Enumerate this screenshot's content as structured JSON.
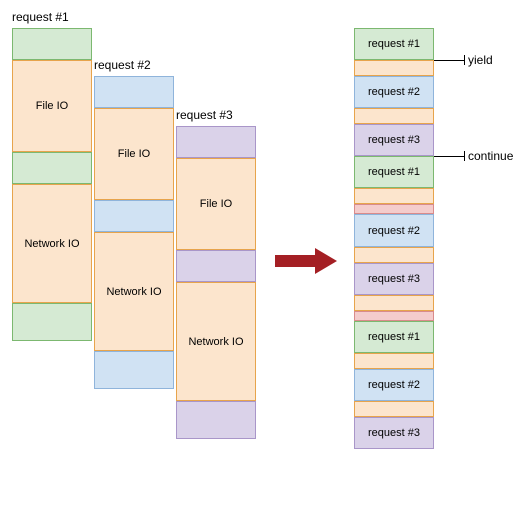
{
  "left": {
    "columns": [
      {
        "title": "request #1",
        "blocks": [
          {
            "color": "green",
            "label": ""
          },
          {
            "color": "orange",
            "label": "File IO"
          },
          {
            "color": "green",
            "label": ""
          },
          {
            "color": "orange",
            "label": "Network IO"
          },
          {
            "color": "green",
            "label": ""
          }
        ]
      },
      {
        "title": "request #2",
        "blocks": [
          {
            "color": "blue",
            "label": ""
          },
          {
            "color": "orange",
            "label": "File IO"
          },
          {
            "color": "blue",
            "label": ""
          },
          {
            "color": "orange",
            "label": "Network IO"
          },
          {
            "color": "blue",
            "label": ""
          }
        ]
      },
      {
        "title": "request #3",
        "blocks": [
          {
            "color": "purple",
            "label": ""
          },
          {
            "color": "orange",
            "label": "File IO"
          },
          {
            "color": "purple",
            "label": ""
          },
          {
            "color": "orange",
            "label": "Network IO"
          },
          {
            "color": "purple",
            "label": ""
          }
        ]
      }
    ]
  },
  "right": {
    "items": [
      {
        "color": "green",
        "label": "request #1"
      },
      {
        "color": "orange",
        "label": ""
      },
      {
        "color": "blue",
        "label": "request #2"
      },
      {
        "color": "orange",
        "label": ""
      },
      {
        "color": "purple",
        "label": "request #3"
      },
      {
        "color": "green",
        "label": "request #1"
      },
      {
        "color": "orange",
        "label": ""
      },
      {
        "color": "pink",
        "label": ""
      },
      {
        "color": "blue",
        "label": "request #2"
      },
      {
        "color": "orange",
        "label": ""
      },
      {
        "color": "purple",
        "label": "request #3"
      },
      {
        "color": "orange",
        "label": ""
      },
      {
        "color": "pink",
        "label": ""
      },
      {
        "color": "green",
        "label": "request #1"
      },
      {
        "color": "orange",
        "label": ""
      },
      {
        "color": "blue",
        "label": "request #2"
      },
      {
        "color": "orange",
        "label": ""
      },
      {
        "color": "purple",
        "label": "request #3"
      }
    ]
  },
  "annotations": {
    "yield": "yield",
    "continue": "continue"
  }
}
